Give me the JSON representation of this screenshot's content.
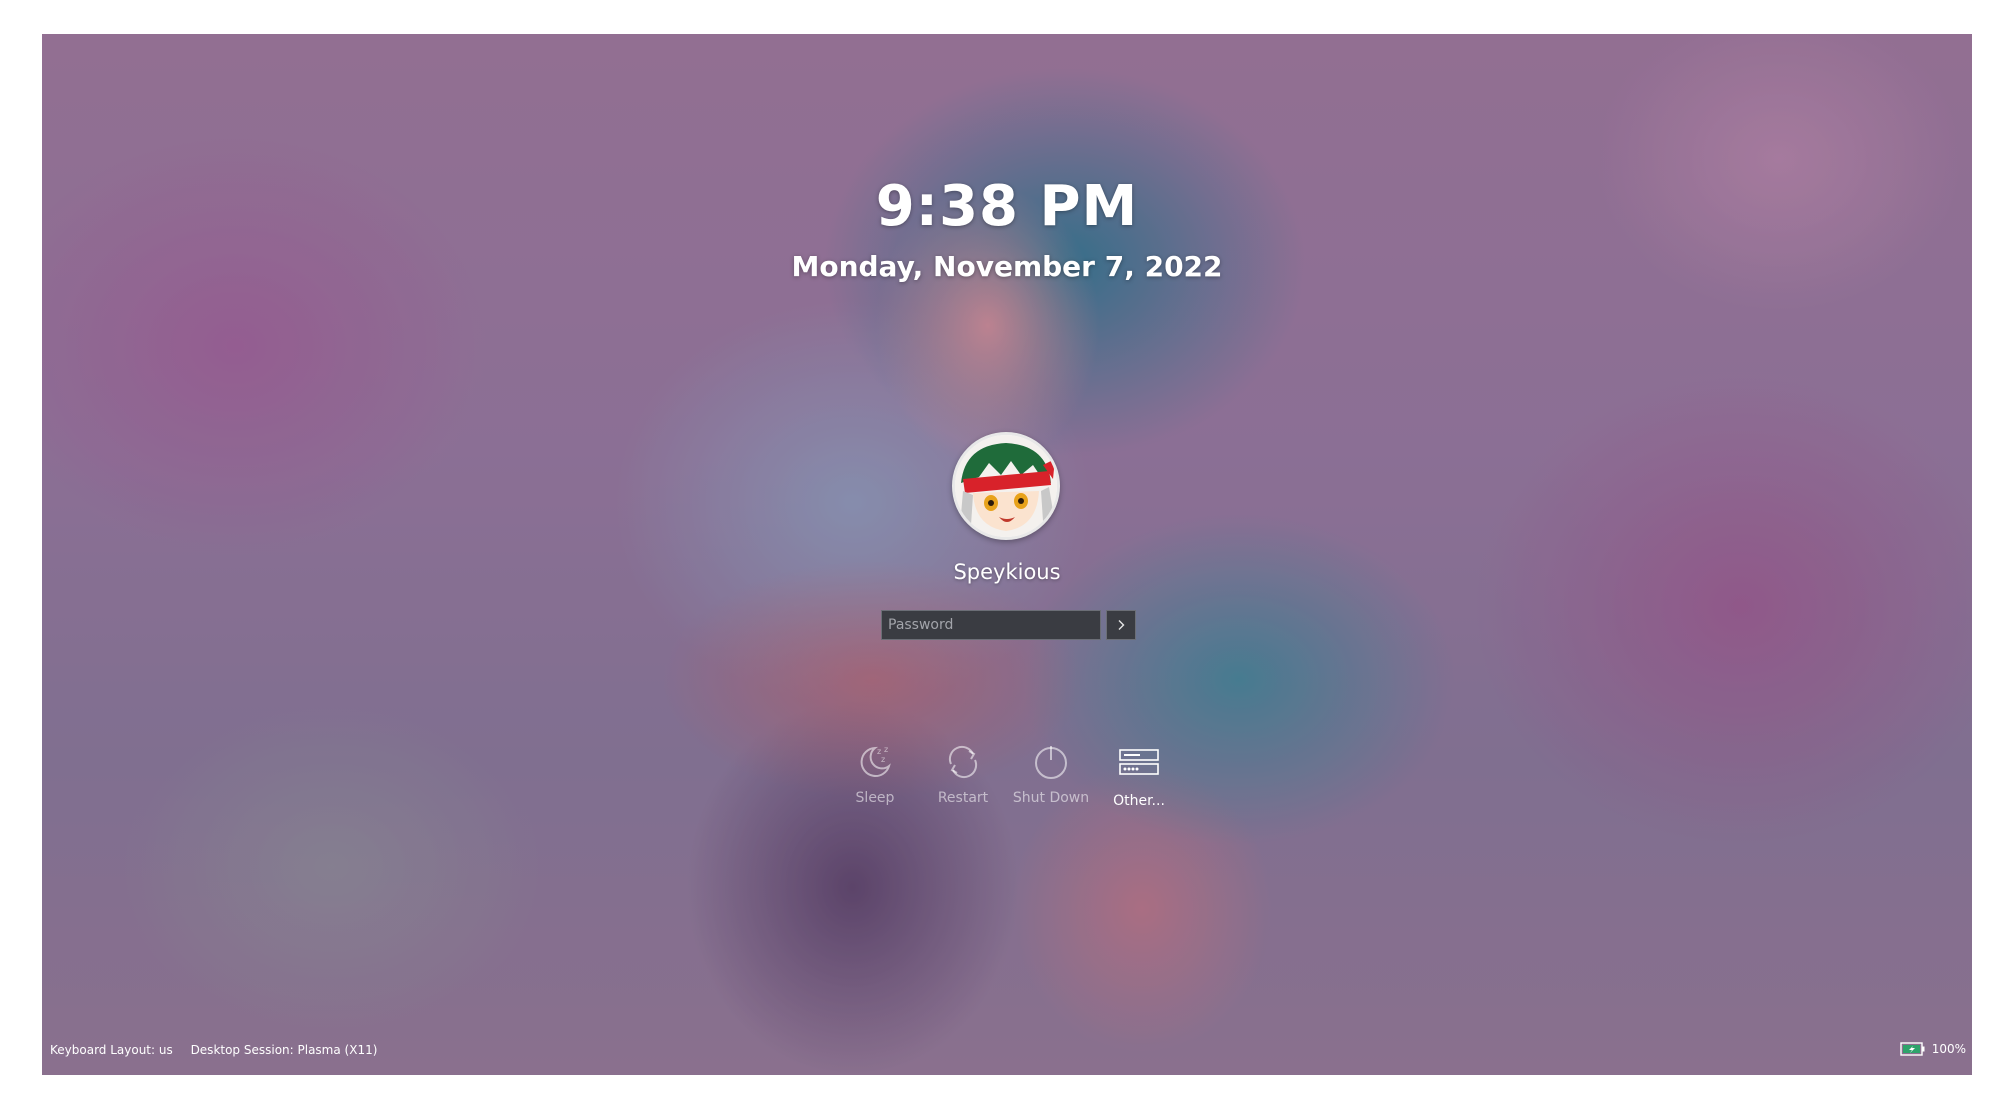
{
  "lockscreen": {
    "time": "9:38 PM",
    "date": "Monday, November 7, 2022",
    "user": {
      "name": "Speykious",
      "avatar_icon": "user-avatar-icon"
    },
    "password": {
      "placeholder": "Password",
      "value": "",
      "submit_icon": "chevron-right-icon"
    },
    "actions": [
      {
        "label": "Sleep",
        "icon": "sleep-moon-icon"
      },
      {
        "label": "Restart",
        "icon": "restart-icon"
      },
      {
        "label": "Shut Down",
        "icon": "power-icon"
      },
      {
        "label": "Other...",
        "icon": "other-users-icon"
      }
    ]
  },
  "footer": {
    "keyboard_layout": "Keyboard Layout: us",
    "desktop_session": "Desktop Session: Plasma (X11)",
    "battery": {
      "icon": "battery-charging-icon",
      "percent_text": "100%",
      "level": 1.0,
      "color": "#2ea36b"
    }
  },
  "colors": {
    "text": "#ffffff",
    "input_bg": "#3a3c42",
    "input_border": "#6b6e76"
  }
}
